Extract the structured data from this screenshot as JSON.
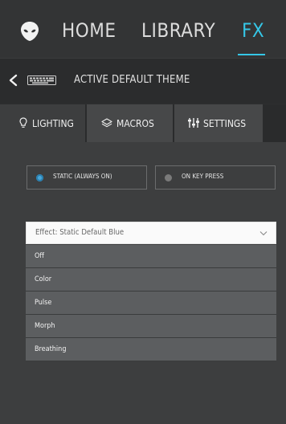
{
  "nav": {
    "home": "HOME",
    "library": "LIBRARY",
    "fx": "FX",
    "active": "FX",
    "accent_color": "#35c6e6"
  },
  "theme": {
    "title": "ACTIVE DEFAULT THEME"
  },
  "tabs": [
    {
      "label": "LIGHTING",
      "icon": "lightbulb-icon",
      "active": true
    },
    {
      "label": "MACROS",
      "icon": "layers-icon",
      "active": false
    },
    {
      "label": "SETTINGS",
      "icon": "sliders-icon",
      "active": false
    }
  ],
  "modes": {
    "static": {
      "label": "STATIC (ALWAYS ON)",
      "selected": true
    },
    "keypress": {
      "label": "ON KEY PRESS",
      "selected": false
    }
  },
  "effect": {
    "selected_text": "Effect: Static Default Blue",
    "options": [
      "Off",
      "Color",
      "Pulse",
      "Morph",
      "Breathing"
    ]
  }
}
